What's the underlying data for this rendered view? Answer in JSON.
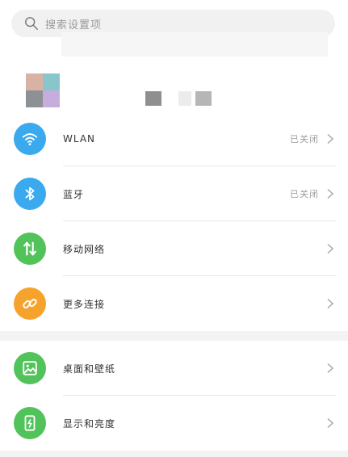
{
  "search": {
    "placeholder": "搜索设置项"
  },
  "sections": [
    {
      "items": [
        {
          "label": "WLAN",
          "status": "已关闭",
          "icon": "wifi-icon",
          "color": "#3aa9ee"
        },
        {
          "label": "蓝牙",
          "status": "已关闭",
          "icon": "bluetooth-icon",
          "color": "#3aa9ee"
        },
        {
          "label": "移动网络",
          "status": "",
          "icon": "mobile-data-icon",
          "color": "#52c25a"
        },
        {
          "label": "更多连接",
          "status": "",
          "icon": "link-icon",
          "color": "#f6a32d"
        }
      ]
    },
    {
      "items": [
        {
          "label": "桌面和壁纸",
          "status": "",
          "icon": "wallpaper-icon",
          "color": "#52c25a"
        },
        {
          "label": "显示和亮度",
          "status": "",
          "icon": "display-icon",
          "color": "#52c25a"
        }
      ]
    }
  ]
}
